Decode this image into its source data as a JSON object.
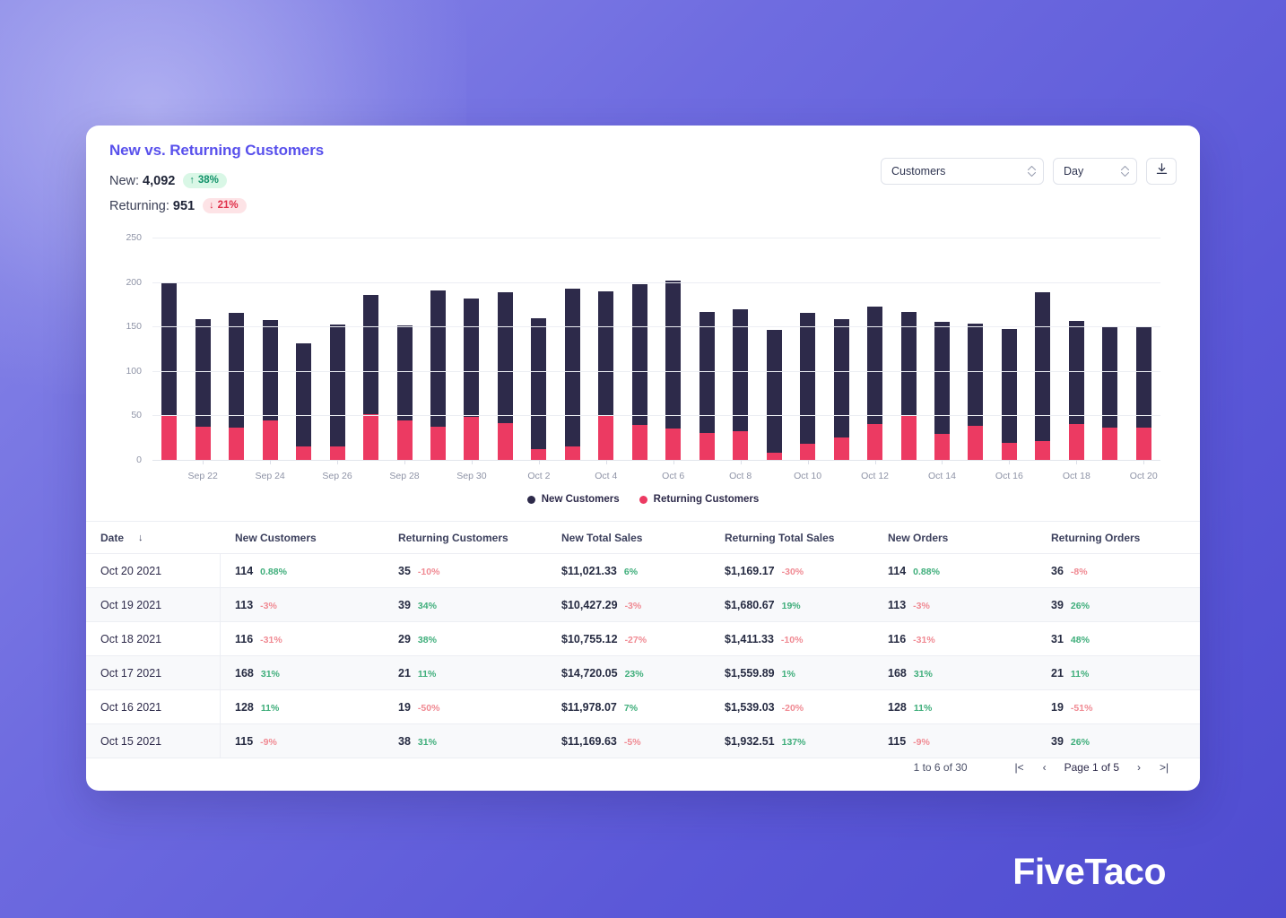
{
  "card": {
    "title": "New vs. Returning Customers",
    "kpis": [
      {
        "label": "New:",
        "value": "4,092",
        "delta": "38%",
        "direction": "up",
        "arrow": "↑"
      },
      {
        "label": "Returning:",
        "value": "951",
        "delta": "21%",
        "direction": "down",
        "arrow": "↓"
      }
    ],
    "controls": {
      "metric_select": "Customers",
      "interval_select": "Day",
      "download_icon": "download-icon"
    }
  },
  "chart_data": {
    "type": "bar",
    "stacked": true,
    "title": "New vs. Returning Customers",
    "xlabel": "",
    "ylabel": "",
    "ylim": [
      0,
      250
    ],
    "yticks": [
      0,
      50,
      100,
      150,
      200,
      250
    ],
    "grid": true,
    "legend_position": "bottom",
    "colors": {
      "new": "#2d2a4a",
      "returning": "#ec3a62"
    },
    "categories": [
      "Sep 21",
      "Sep 22",
      "Sep 23",
      "Sep 24",
      "Sep 25",
      "Sep 26",
      "Sep 27",
      "Sep 28",
      "Sep 29",
      "Sep 30",
      "Oct 1",
      "Oct 2",
      "Oct 3",
      "Oct 4",
      "Oct 5",
      "Oct 6",
      "Oct 7",
      "Oct 8",
      "Oct 9",
      "Oct 10",
      "Oct 11",
      "Oct 12",
      "Oct 13",
      "Oct 14",
      "Oct 15",
      "Oct 16",
      "Oct 17",
      "Oct 18",
      "Oct 19",
      "Oct 20"
    ],
    "tick_labels": [
      "Sep 22",
      "Sep 24",
      "Sep 26",
      "Sep 28",
      "Sep 30",
      "Oct 2",
      "Oct 4",
      "Oct 6",
      "Oct 8",
      "Oct 10",
      "Oct 12",
      "Oct 14",
      "Oct 16",
      "Oct 18",
      "Oct 20"
    ],
    "tick_indices": [
      1,
      3,
      5,
      7,
      9,
      11,
      13,
      15,
      17,
      19,
      21,
      23,
      25,
      27,
      29
    ],
    "series": [
      {
        "name": "Returning Customers",
        "values": [
          49,
          37,
          36,
          44,
          15,
          15,
          51,
          44,
          37,
          48,
          41,
          12,
          15,
          49,
          39,
          35,
          30,
          32,
          8,
          18,
          25,
          40,
          49,
          29,
          38,
          19,
          21,
          40,
          36,
          36
        ]
      },
      {
        "name": "New Customers",
        "values": [
          151,
          121,
          129,
          113,
          116,
          137,
          135,
          107,
          154,
          133,
          148,
          147,
          178,
          141,
          159,
          167,
          136,
          137,
          138,
          147,
          133,
          132,
          117,
          126,
          115,
          128,
          168,
          116,
          113,
          114
        ]
      }
    ],
    "totals": [
      200,
      158,
      165,
      157,
      131,
      152,
      186,
      151,
      191,
      181,
      189,
      159,
      193,
      190,
      198,
      202,
      166,
      169,
      146,
      165,
      158,
      172,
      166,
      155,
      153,
      147,
      189,
      145,
      152,
      150
    ],
    "legend": [
      "New Customers",
      "Returning Customers"
    ]
  },
  "table": {
    "columns": [
      {
        "key": "date",
        "label": "Date",
        "sort_icon": "↓"
      },
      {
        "key": "new_customers",
        "label": "New Customers"
      },
      {
        "key": "returning_customers",
        "label": "Returning Customers"
      },
      {
        "key": "new_total_sales",
        "label": "New Total Sales"
      },
      {
        "key": "returning_total_sales",
        "label": "Returning Total Sales"
      },
      {
        "key": "new_orders",
        "label": "New Orders"
      },
      {
        "key": "returning_orders",
        "label": "Returning Orders"
      }
    ],
    "rows": [
      {
        "date": "Oct 20 2021",
        "new_customers": {
          "value": "114",
          "delta": "0.88%",
          "sign": "pos"
        },
        "returning_customers": {
          "value": "35",
          "delta": "-10%",
          "sign": "neg"
        },
        "new_total_sales": {
          "value": "$11,021.33",
          "delta": "6%",
          "sign": "pos"
        },
        "returning_total_sales": {
          "value": "$1,169.17",
          "delta": "-30%",
          "sign": "neg"
        },
        "new_orders": {
          "value": "114",
          "delta": "0.88%",
          "sign": "pos"
        },
        "returning_orders": {
          "value": "36",
          "delta": "-8%",
          "sign": "neg"
        }
      },
      {
        "date": "Oct 19 2021",
        "new_customers": {
          "value": "113",
          "delta": "-3%",
          "sign": "neg"
        },
        "returning_customers": {
          "value": "39",
          "delta": "34%",
          "sign": "pos"
        },
        "new_total_sales": {
          "value": "$10,427.29",
          "delta": "-3%",
          "sign": "neg"
        },
        "returning_total_sales": {
          "value": "$1,680.67",
          "delta": "19%",
          "sign": "pos"
        },
        "new_orders": {
          "value": "113",
          "delta": "-3%",
          "sign": "neg"
        },
        "returning_orders": {
          "value": "39",
          "delta": "26%",
          "sign": "pos"
        }
      },
      {
        "date": "Oct 18 2021",
        "new_customers": {
          "value": "116",
          "delta": "-31%",
          "sign": "neg"
        },
        "returning_customers": {
          "value": "29",
          "delta": "38%",
          "sign": "pos"
        },
        "new_total_sales": {
          "value": "$10,755.12",
          "delta": "-27%",
          "sign": "neg"
        },
        "returning_total_sales": {
          "value": "$1,411.33",
          "delta": "-10%",
          "sign": "neg"
        },
        "new_orders": {
          "value": "116",
          "delta": "-31%",
          "sign": "neg"
        },
        "returning_orders": {
          "value": "31",
          "delta": "48%",
          "sign": "pos"
        }
      },
      {
        "date": "Oct 17 2021",
        "new_customers": {
          "value": "168",
          "delta": "31%",
          "sign": "pos"
        },
        "returning_customers": {
          "value": "21",
          "delta": "11%",
          "sign": "pos"
        },
        "new_total_sales": {
          "value": "$14,720.05",
          "delta": "23%",
          "sign": "pos"
        },
        "returning_total_sales": {
          "value": "$1,559.89",
          "delta": "1%",
          "sign": "pos"
        },
        "new_orders": {
          "value": "168",
          "delta": "31%",
          "sign": "pos"
        },
        "returning_orders": {
          "value": "21",
          "delta": "11%",
          "sign": "pos"
        }
      },
      {
        "date": "Oct 16 2021",
        "new_customers": {
          "value": "128",
          "delta": "11%",
          "sign": "pos"
        },
        "returning_customers": {
          "value": "19",
          "delta": "-50%",
          "sign": "neg"
        },
        "new_total_sales": {
          "value": "$11,978.07",
          "delta": "7%",
          "sign": "pos"
        },
        "returning_total_sales": {
          "value": "$1,539.03",
          "delta": "-20%",
          "sign": "neg"
        },
        "new_orders": {
          "value": "128",
          "delta": "11%",
          "sign": "pos"
        },
        "returning_orders": {
          "value": "19",
          "delta": "-51%",
          "sign": "neg"
        }
      },
      {
        "date": "Oct 15 2021",
        "new_customers": {
          "value": "115",
          "delta": "-9%",
          "sign": "neg"
        },
        "returning_customers": {
          "value": "38",
          "delta": "31%",
          "sign": "pos"
        },
        "new_total_sales": {
          "value": "$11,169.63",
          "delta": "-5%",
          "sign": "neg"
        },
        "returning_total_sales": {
          "value": "$1,932.51",
          "delta": "137%",
          "sign": "pos"
        },
        "new_orders": {
          "value": "115",
          "delta": "-9%",
          "sign": "neg"
        },
        "returning_orders": {
          "value": "39",
          "delta": "26%",
          "sign": "pos"
        }
      }
    ]
  },
  "footer": {
    "range_text": "1 to 6 of 30",
    "page_text": "Page 1 of 5",
    "first_icon": "|<",
    "prev_icon": "‹",
    "next_icon": "›",
    "last_icon": ">|"
  },
  "brand": {
    "name": "FiveTaco"
  }
}
